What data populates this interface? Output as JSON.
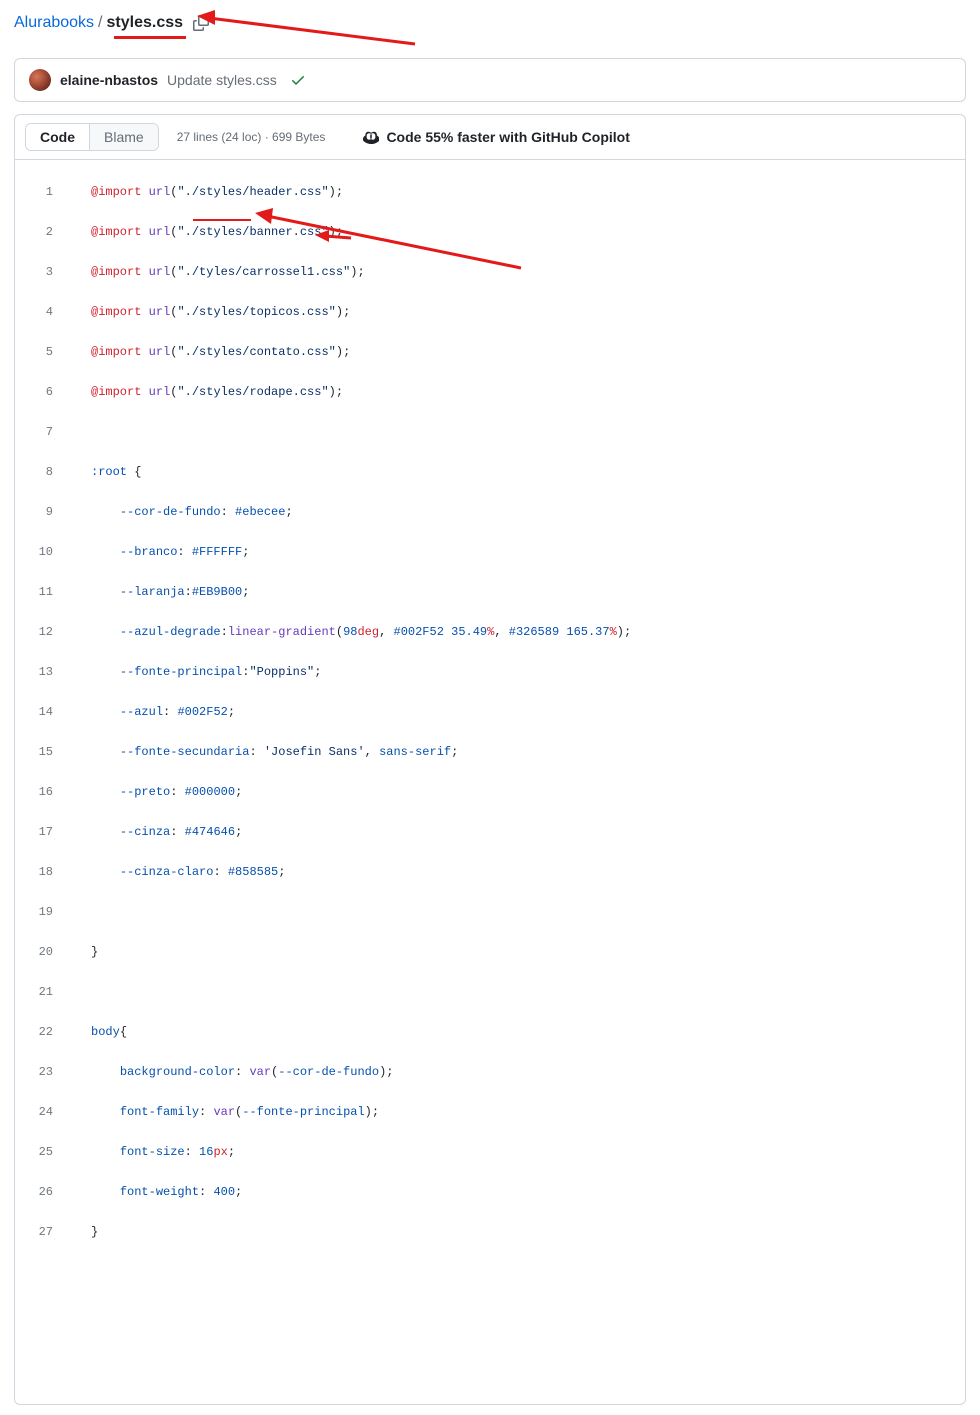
{
  "breadcrumb": {
    "repo": "Alurabooks",
    "sep": "/",
    "file": "styles.css"
  },
  "commit": {
    "author": "elaine-nbastos",
    "message": "Update styles.css"
  },
  "tabs": {
    "code": "Code",
    "blame": "Blame"
  },
  "fileinfo": "27 lines (24 loc) · 699 Bytes",
  "copilot_promo": "Code 55% faster with GitHub Copilot",
  "code_lines": {
    "l1_imp": "@import",
    "l1_fn": "url",
    "l1_str": "\"./styles/header.css\"",
    "l2_imp": "@import",
    "l2_fn": "url",
    "l2_str": "\"./styles/banner.css\"",
    "l3_imp": "@import",
    "l3_fn": "url",
    "l3_str": "\"./tyles/carrossel1.css\"",
    "l4_imp": "@import",
    "l4_fn": "url",
    "l4_str": "\"./styles/topicos.css\"",
    "l5_imp": "@import",
    "l5_fn": "url",
    "l5_str": "\"./styles/contato.css\"",
    "l6_imp": "@import",
    "l6_fn": "url",
    "l6_str": "\"./styles/rodape.css\"",
    "l8_sel": ":root",
    "l9_prop": "--cor-de-fundo",
    "l9_val": "#ebecee",
    "l10_prop": "--branco",
    "l10_val": "#FFFFFF",
    "l11_prop": "--laranja",
    "l11_val": "#EB9B00",
    "l12_prop": "--azul-degrade",
    "l12_fn": "linear-gradient",
    "l12_arg1_n": "98",
    "l12_arg1_u": "deg",
    "l12_arg2": "#002F52",
    "l12_arg2_n": "35.49",
    "l12_arg2_u": "%",
    "l12_arg3": "#326589",
    "l12_arg3_n": "165.37",
    "l12_arg3_u": "%",
    "l13_prop": "--fonte-principal",
    "l13_val": "\"Poppins\"",
    "l14_prop": "--azul",
    "l14_val": "#002F52",
    "l15_prop": "--fonte-secundaria",
    "l15_val": "'Josefin Sans'",
    "l15_fallback": "sans-serif",
    "l16_prop": "--preto",
    "l16_val": "#000000",
    "l17_prop": "--cinza",
    "l17_val": "#474646",
    "l18_prop": "--cinza-claro",
    "l18_val": "#858585",
    "l22_sel": "body",
    "l23_prop": "background-color",
    "l23_fn": "var",
    "l23_arg": "--cor-de-fundo",
    "l24_prop": "font-family",
    "l24_fn": "var",
    "l24_arg": "--fonte-principal",
    "l25_prop": "font-size",
    "l25_n": "16",
    "l25_u": "px",
    "l26_prop": "font-weight",
    "l26_n": "400"
  },
  "line_numbers": {
    "n1": "1",
    "n2": "2",
    "n3": "3",
    "n4": "4",
    "n5": "5",
    "n6": "6",
    "n7": "7",
    "n8": "8",
    "n9": "9",
    "n10": "10",
    "n11": "11",
    "n12": "12",
    "n13": "13",
    "n14": "14",
    "n15": "15",
    "n16": "16",
    "n17": "17",
    "n18": "18",
    "n19": "19",
    "n20": "20",
    "n21": "21",
    "n22": "22",
    "n23": "23",
    "n24": "24",
    "n25": "25",
    "n26": "26",
    "n27": "27"
  }
}
